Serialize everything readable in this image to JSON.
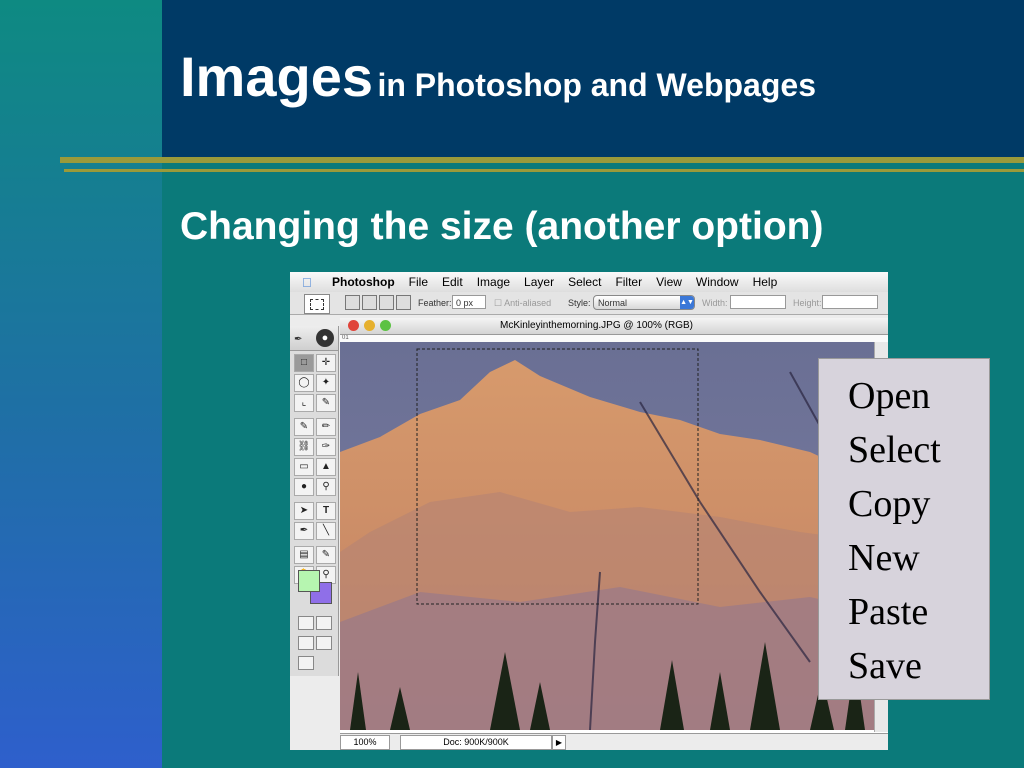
{
  "slide": {
    "title_main": "Images",
    "title_rest": "in Photoshop and Webpages",
    "subtitle": "Changing the size (another option)"
  },
  "menubar": {
    "app_name": "Photoshop",
    "items": [
      "File",
      "Edit",
      "Image",
      "Layer",
      "Select",
      "Filter",
      "View",
      "Window",
      "Help"
    ]
  },
  "options_bar": {
    "feather_label": "Feather:",
    "feather_value": "0 px",
    "antialiased_label": "Anti-aliased",
    "style_label": "Style:",
    "style_value": "Normal",
    "width_label": "Width:",
    "height_label": "Height:"
  },
  "document": {
    "title": "McKinleyinthemorning.JPG @ 100% (RGB)",
    "ruler_label": "01",
    "zoom": "100%",
    "doc_info": "Doc: 900K/900K"
  },
  "colors": {
    "foreground": "#b6f5b0",
    "background": "#8f6fe8",
    "accent_rule": "#9a9a3a",
    "title_bar": "#003a66"
  },
  "steps": [
    "Open",
    "Select",
    "Copy",
    "New",
    "Paste",
    "Save"
  ]
}
